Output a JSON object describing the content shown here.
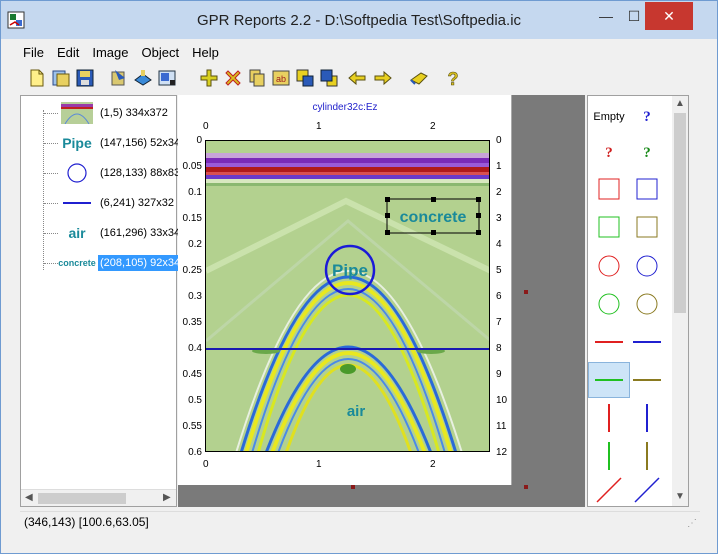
{
  "window": {
    "title": "GPR Reports 2.2 - D:\\Softpedia Test\\Softpedia.ic",
    "minimize": "—",
    "maximize": "☐",
    "close": "✕"
  },
  "menu": [
    "File",
    "Edit",
    "Image",
    "Object",
    "Help"
  ],
  "toolbar": [
    "new-icon",
    "open-icon",
    "save-icon",
    "import-icon",
    "export-icon",
    "print-icon",
    "add-icon",
    "delete-icon",
    "copy-icon",
    "paste-icon",
    "bring-front-icon",
    "send-back-icon",
    "undo-icon",
    "redo-icon",
    "pointer-icon",
    "help-icon"
  ],
  "tree": {
    "items": [
      {
        "thumb": "image",
        "label": "(1,5) 334x372"
      },
      {
        "thumb": "Pipe",
        "label": "(147,156) 52x34"
      },
      {
        "thumb": "circle",
        "label": "(128,133) 88x83"
      },
      {
        "thumb": "line",
        "label": "(6,241) 327x32"
      },
      {
        "thumb": "air",
        "label": "(161,296) 33x34"
      },
      {
        "thumb": "concrete",
        "label": "(208,105) 92x34",
        "selected": true
      }
    ]
  },
  "plot": {
    "title": "cylinder32c:Ez",
    "top_ticks": [
      "0",
      "1",
      "2"
    ],
    "bottom_ticks": [
      "0",
      "1",
      "2"
    ],
    "left_ticks": [
      "0",
      "0.05",
      "0.1",
      "0.15",
      "0.2",
      "0.25",
      "0.3",
      "0.35",
      "0.4",
      "0.45",
      "0.5",
      "0.55",
      "0.6"
    ],
    "right_ticks": [
      "0",
      "1",
      "2",
      "3",
      "4",
      "5",
      "6",
      "7",
      "8",
      "9",
      "10",
      "11",
      "12"
    ],
    "annotations": {
      "concrete": "concrete",
      "pipe": "Pipe",
      "air": "air"
    }
  },
  "palette": {
    "empty_label": "Empty",
    "q_blue": "?",
    "q_red": "?",
    "q_green": "?",
    "colors": {
      "red": "#e02020",
      "blue": "#2020d0",
      "green": "#20c020",
      "olive": "#8a7a20"
    }
  },
  "status": {
    "text": "(346,143) [100.6,63.05]"
  }
}
